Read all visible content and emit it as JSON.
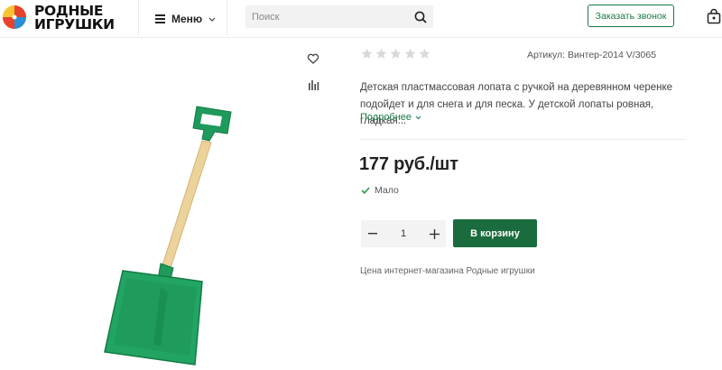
{
  "header": {
    "logo": {
      "line1": "РОДНЫЕ",
      "line2": "ИГРУШКИ",
      "icon": "beach-ball-icon"
    },
    "menu_label": "Меню",
    "search": {
      "placeholder": "Поиск",
      "value": ""
    },
    "callback_label": "Заказать звонок",
    "cart_icon": "shopping-bag-icon"
  },
  "product": {
    "rating": {
      "value": 0,
      "max": 5
    },
    "sku": "Артикул: Винтер-2014 V/3065",
    "description": "Детская пластмассовая лопата с ручкой на деревянном черенке подойдет и для снега и для песка. У детской лопаты ровная, гладкая...",
    "more_label": "Подробнее",
    "price": "177 руб./шт",
    "stock_label": "Мало",
    "quantity": "1",
    "add_to_cart_label": "В корзину",
    "price_note": "Цена интернет-магазина Родные игрушки",
    "image_icon": "shovel-icon",
    "side_icons": [
      "heart-icon",
      "compare-icon"
    ]
  },
  "colors": {
    "accent": "#1a7a45",
    "button": "#1a6b3d",
    "shovel_blade": "#1e9a5a",
    "shovel_handle": "#e8c98a",
    "star": "#d9d9d9"
  }
}
